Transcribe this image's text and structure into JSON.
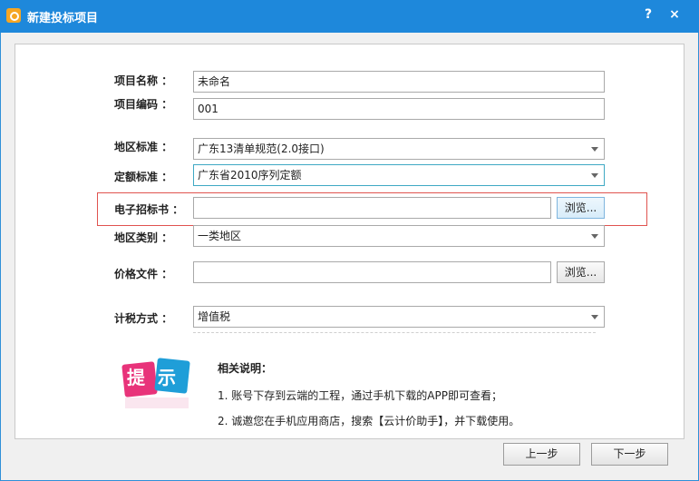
{
  "window": {
    "title": "新建投标项目",
    "help_label": "?",
    "close_label": "×"
  },
  "form": {
    "project_name": {
      "label": "项目名称 ：",
      "value": "未命名"
    },
    "project_code": {
      "label": "项目编码 ：",
      "value": "001"
    },
    "region_standard": {
      "label": "地区标准 ：",
      "value": "广东13清单规范(2.0接口)"
    },
    "quota_standard": {
      "label": "定额标准 ：",
      "value": "广东省2010序列定额"
    },
    "e_tender_doc": {
      "label": "电子招标书 ：",
      "value": "",
      "browse_label": "浏览..."
    },
    "region_type": {
      "label": "地区类别 ：",
      "value": "一类地区"
    },
    "price_file": {
      "label": "价格文件 ：",
      "value": "",
      "browse_label": "浏览..."
    },
    "tax_method": {
      "label": "计税方式 ：",
      "value": "增值税"
    }
  },
  "tips": {
    "logo_text": "提示",
    "title": "相关说明：",
    "line1": "1. 账号下存到云端的工程，通过手机下载的APP即可查看；",
    "line2": "2. 诚邀您在手机应用商店，搜索【云计价助手】，并下载使用。"
  },
  "buttons": {
    "prev_label": "上一步",
    "next_label": "下一步"
  },
  "colors": {
    "titlebar": "#1e88db",
    "highlight_border": "#e0534f",
    "logo_pink": "#e8337a",
    "logo_blue": "#1f9ed8"
  }
}
